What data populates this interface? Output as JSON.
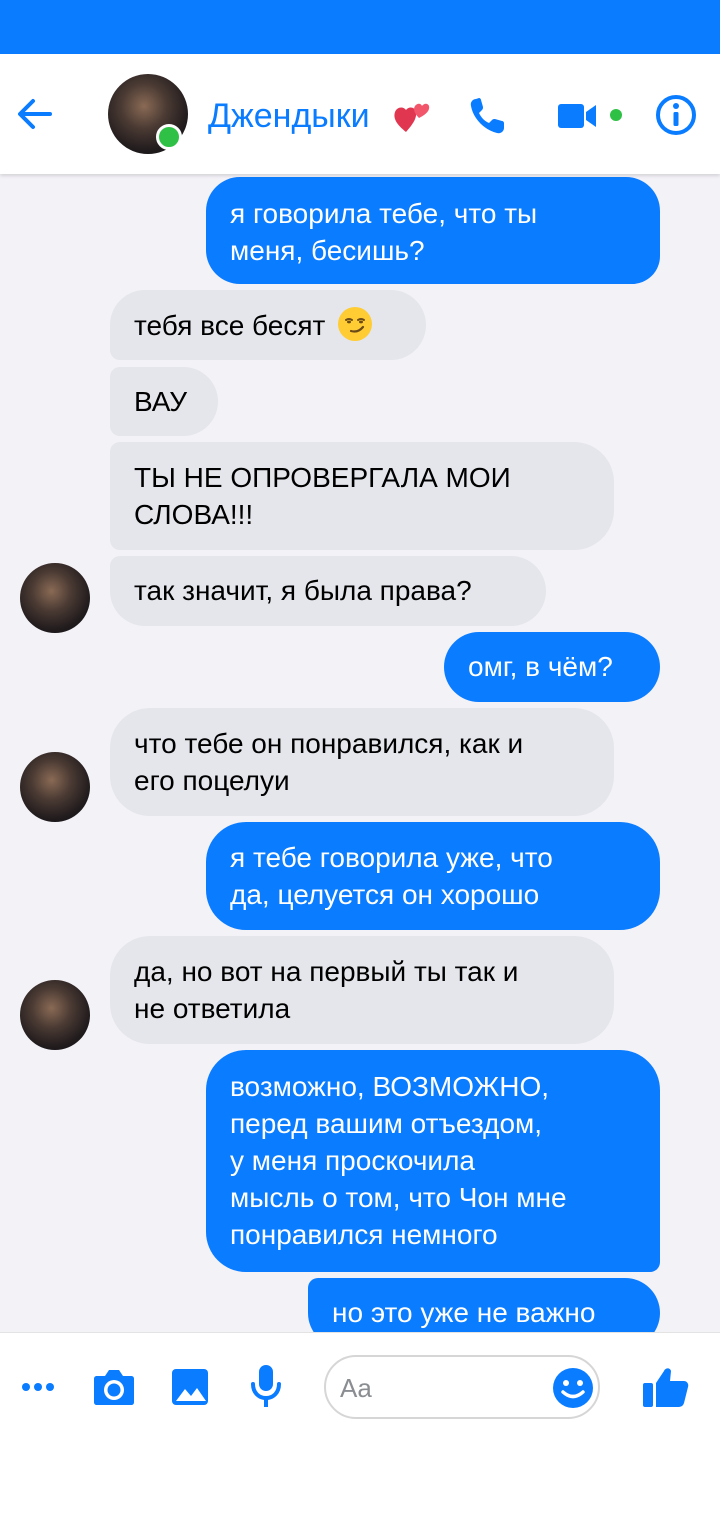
{
  "header": {
    "title": "Джендыки",
    "heart_emoji": "💕"
  },
  "messages": [
    {
      "side": "out",
      "lines": [
        "я говорила тебе, что ты",
        "меня, бесишь?"
      ]
    },
    {
      "side": "in",
      "lines": [
        "тебя все бесят"
      ],
      "emoji": "smirking-face"
    },
    {
      "side": "in",
      "lines": [
        "ВАУ"
      ]
    },
    {
      "side": "in",
      "lines": [
        "ТЫ НЕ ОПРОВЕРГАЛА МОИ",
        "СЛОВА!!!"
      ]
    },
    {
      "side": "in",
      "lines": [
        "так значит, я была права?"
      ],
      "avatar": true
    },
    {
      "side": "out",
      "lines": [
        "омг, в чём?"
      ]
    },
    {
      "side": "in",
      "lines": [
        "что тебе он понравился, как и",
        "его поцелуи"
      ],
      "avatar": true
    },
    {
      "side": "out",
      "lines": [
        "я тебе говорила уже, что",
        "да, целуется он хорошо"
      ]
    },
    {
      "side": "in",
      "lines": [
        "да, но вот на первый ты так и",
        "не ответила"
      ],
      "avatar": true
    },
    {
      "side": "out",
      "lines": [
        "возможно, ВОЗМОЖНО,",
        "перед вашим отъездом,",
        "у меня проскочила",
        "мысль о том, что Чон мне",
        "понравился немного"
      ]
    },
    {
      "side": "out",
      "lines": [
        "но это уже не важно"
      ]
    }
  ],
  "composer": {
    "placeholder": "Aa"
  },
  "icons": {
    "header": [
      "back-arrow-icon",
      "avatar",
      "heart-icon",
      "phone-icon",
      "video-camera-icon",
      "info-icon"
    ],
    "composer": [
      "more-icon",
      "camera-icon",
      "image-icon",
      "microphone-icon",
      "emoji-icon",
      "thumbs-up-icon"
    ]
  },
  "colors": {
    "accent": "#0a7cff",
    "incoming_bubble": "#e4e6eb",
    "online": "#2fc145",
    "thread_background": "#f3f2f7"
  }
}
